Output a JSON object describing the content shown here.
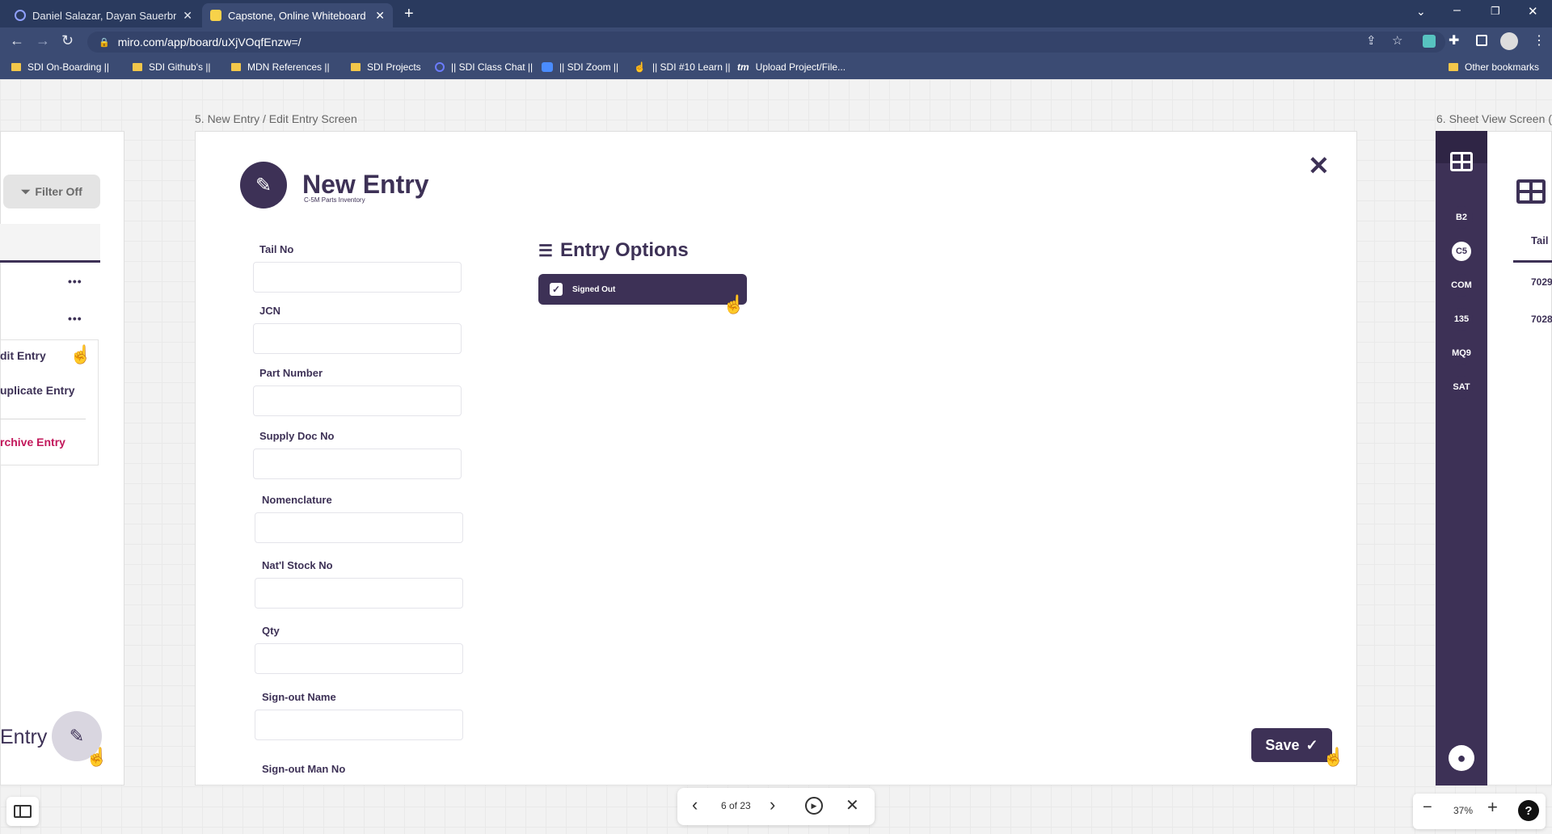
{
  "browser": {
    "tabs": [
      {
        "title": "Daniel Salazar, Dayan Sauerbronn",
        "active": false
      },
      {
        "title": "Capstone, Online Whiteboard for",
        "active": true
      }
    ],
    "new_tab": "+",
    "url": "miro.com/app/board/uXjVOqfEnzw=/",
    "bookmarks": [
      "SDI On-Boarding ||",
      "SDI Github's ||",
      "MDN References ||",
      "SDI Projects",
      "|| SDI Class Chat ||",
      "|| SDI Zoom ||",
      "|| SDI #10 Learn ||",
      "Upload Project/File..."
    ],
    "other_bookmarks": "Other bookmarks"
  },
  "left_frame": {
    "filter_label": "Filter Off",
    "menu": [
      "dit Entry",
      "uplicate Entry",
      "rchive Entry"
    ],
    "bottom_text": "Entry",
    "more": "•••"
  },
  "frame5": {
    "label": "5. New Entry / Edit Entry Screen",
    "title": "New Entry",
    "subtitle": "C-5M Parts Inventory",
    "close": "✕",
    "fields": [
      "Tail No",
      "JCN",
      "Part Number",
      "Supply Doc No",
      "Nomenclature",
      "Nat'l Stock No",
      "Qty",
      "Sign-out Name",
      "Sign-out Man No"
    ],
    "options_title": "Entry Options",
    "option_label": "Signed Out",
    "save_label": "Save"
  },
  "frame6": {
    "label": "6. Sheet View Screen (",
    "rail": [
      "B2",
      "C5",
      "COM",
      "135",
      "MQ9",
      "SAT"
    ],
    "col_header": "Tail",
    "rows": [
      "7029",
      "7028"
    ]
  },
  "presentation": {
    "counter": "6 of 23"
  },
  "zoom": {
    "level": "37%",
    "minus": "−",
    "plus": "+",
    "help": "?"
  },
  "colors": {
    "brand": "#3d3156",
    "accent_hand": "#f2c230",
    "archive": "#c2185b"
  }
}
